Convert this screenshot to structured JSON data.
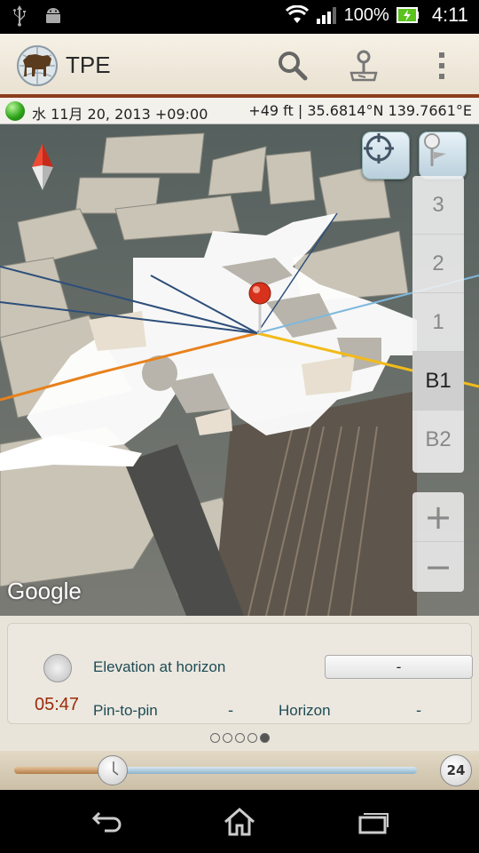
{
  "status_bar": {
    "battery": "100%",
    "time": "4:11",
    "icons": [
      "usb-icon",
      "android-debug-icon",
      "wifi-icon",
      "signal-icon",
      "battery-icon"
    ]
  },
  "action_bar": {
    "title": "TPE",
    "actions": [
      "search-icon",
      "pin-map-icon",
      "overflow-menu-icon"
    ]
  },
  "info_bar": {
    "date": "水 11月 20, 2013 +09:00",
    "coordinates": "+49 ft | 35.6814°N 139.7661°E"
  },
  "map": {
    "attribution": "Google",
    "floors": [
      "3",
      "2",
      "1",
      "B1",
      "B2"
    ],
    "selected_floor": "B1",
    "zoom_in": "+",
    "zoom_out": "−",
    "colors": {
      "orange_line": "#e8811c",
      "yellow_line": "#f2bb1a",
      "blue_line": "#2d4e7a",
      "light_blue_line": "#7fb8dc",
      "pin": "#d8321c"
    }
  },
  "details": {
    "time": "05:47",
    "elevation_label": "Elevation at horizon",
    "elevation_value": "-",
    "pin_to_pin_label": "Pin-to-pin",
    "pin_to_pin_value": "-",
    "horizon_label": "Horizon",
    "horizon_value": "-",
    "page_count": 5,
    "active_page": 5
  },
  "slider": {
    "label_24": "24"
  },
  "nav": [
    "back-icon",
    "home-icon",
    "recent-apps-icon"
  ]
}
